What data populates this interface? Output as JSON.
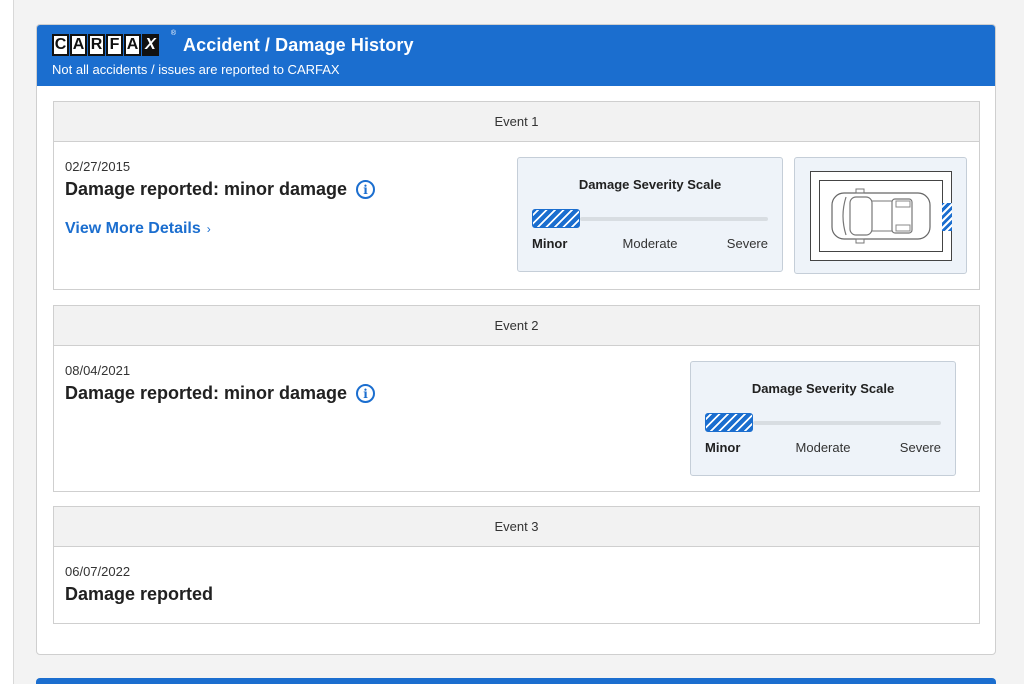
{
  "header": {
    "logo_letters": [
      "C",
      "A",
      "R",
      "F",
      "A",
      "X"
    ],
    "logo_text": "CARFAX",
    "logo_reg": "®",
    "title": "Accident / Damage History",
    "subtitle": "Not all accidents / issues are reported to CARFAX"
  },
  "events": [
    {
      "label": "Event 1",
      "date": "02/27/2015",
      "title": "Damage reported: minor damage",
      "link": "View More Details",
      "scale": {
        "title": "Damage Severity Scale",
        "minor": "Minor",
        "moderate": "Moderate",
        "severe": "Severe",
        "level": "Minor"
      },
      "impact_side": "right"
    },
    {
      "label": "Event 2",
      "date": "08/04/2021",
      "title": "Damage reported: minor damage",
      "scale": {
        "title": "Damage Severity Scale",
        "minor": "Minor",
        "moderate": "Moderate",
        "severe": "Severe",
        "level": "Minor"
      }
    },
    {
      "label": "Event 3",
      "date": "06/07/2022",
      "title": "Damage reported"
    }
  ],
  "icons": {
    "info": "info-icon",
    "chevron": "chevron-right-icon",
    "car": "car-top-view-icon"
  },
  "colors": {
    "brand_blue": "#1b6ecf",
    "severity_fill": "#1b6ecf"
  }
}
